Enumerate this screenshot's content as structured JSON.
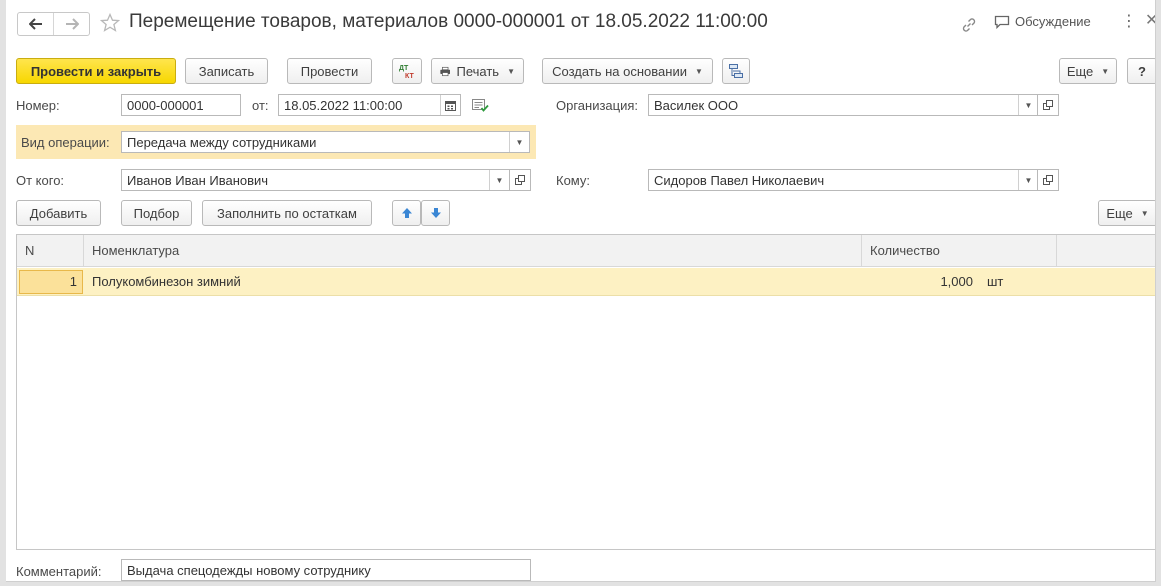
{
  "header": {
    "title": "Перемещение товаров, материалов 0000-000001 от 18.05.2022 11:00:00",
    "discussion_label": "Обсуждение"
  },
  "toolbar": {
    "post_close": "Провести и закрыть",
    "save": "Записать",
    "post": "Провести",
    "dt_kt_icon": "dt-kt-icon",
    "print": "Печать",
    "create_based": "Создать на основании",
    "more": "Еще",
    "help": "?"
  },
  "form": {
    "number_label": "Номер:",
    "number_value": "0000-000001",
    "date_label": "от:",
    "date_value": "18.05.2022 11:00:00",
    "org_label": "Организация:",
    "org_value": "Василек ООО",
    "op_label": "Вид операции:",
    "op_value": "Передача между сотрудниками",
    "from_label": "От кого:",
    "from_value": "Иванов Иван Иванович",
    "to_label": "Кому:",
    "to_value": "Сидоров Павел Николаевич"
  },
  "table_toolbar": {
    "add": "Добавить",
    "select": "Подбор",
    "fill": "Заполнить по остаткам",
    "more": "Еще"
  },
  "table": {
    "columns": [
      "N",
      "Номенклатура",
      "Количество"
    ],
    "rows": [
      {
        "n": "1",
        "item": "Полукомбинезон зимний",
        "qty": "1,000",
        "unit": "шт"
      }
    ]
  },
  "footer": {
    "comment_label": "Комментарий:",
    "comment_value": "Выдача спецодежды новому сотруднику"
  },
  "colors": {
    "primary_button": "#f7d700",
    "selected_row": "#fdf1c3",
    "operation_highlight": "#fce8b4"
  }
}
